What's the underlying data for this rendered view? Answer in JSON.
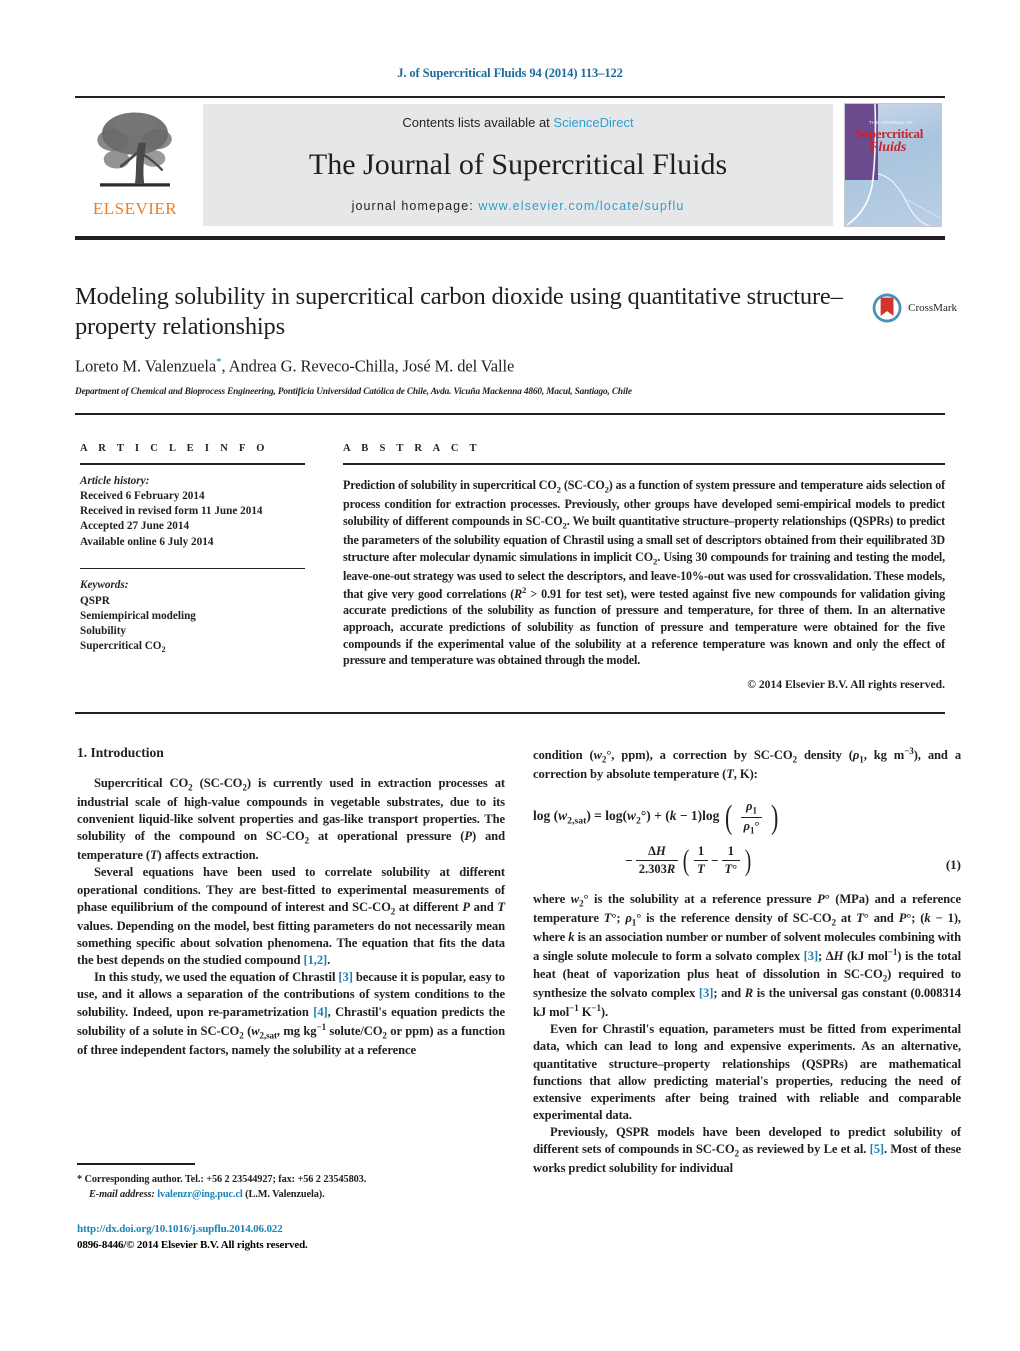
{
  "running_head": "J. of Supercritical Fluids 94 (2014) 113–122",
  "masthead": {
    "publisher_name": "ELSEVIER",
    "contents_prefix": "Contents lists available at ",
    "contents_link": "ScienceDirect",
    "journal_title": "The Journal of Supercritical Fluids",
    "homepage_prefix": "journal homepage: ",
    "homepage_url": "www.elsevier.com/locate/supflu",
    "cover": {
      "line1": "THE JOURNAL OF",
      "line2": "Supercritical",
      "line3": "Fluids"
    }
  },
  "title": "Modeling solubility in supercritical carbon dioxide using quantitative structure–property relationships",
  "authors_html": "Loreto M. Valenzuela<sup>*</sup>, Andrea G. Reveco-Chilla, José M. del Valle",
  "affiliation": "Department of Chemical and Bioprocess Engineering, Pontificia Universidad Católica de Chile, Avda. Vicuña Mackenna 4860, Macul, Santiago, Chile",
  "crossmark_label": "CrossMark",
  "article_info": {
    "heading": "A R T I C L E    I N F O",
    "history_label": "Article history:",
    "history": [
      "Received 6 February 2014",
      "Received in revised form 11 June 2014",
      "Accepted 27 June 2014",
      "Available online 6 July 2014"
    ],
    "keywords_label": "Keywords:",
    "keywords_html": [
      "QSPR",
      "Semiempirical modeling",
      "Solubility",
      "Supercritical CO<sub>2</sub>"
    ]
  },
  "abstract": {
    "heading": "A B S T R A C T",
    "body_html": "Prediction of solubility in supercritical CO<sub>2</sub> (SC-CO<sub>2</sub>) as a function of system pressure and temperature aids selection of process condition for extraction processes. Previously, other groups have developed semi-empirical models to predict solubility of different compounds in SC-CO<sub>2</sub>. We built quantitative structure–property relationships (QSPRs) to predict the parameters of the solubility equation of Chrastil using a small set of descriptors obtained from their equilibrated 3D structure after molecular dynamic simulations in implicit CO<sub>2</sub>. Using 30 compounds for training and testing the model, leave-one-out strategy was used to select the descriptors, and leave-10%-out was used for crossvalidation. These models, that give very good correlations (<i>R</i><sup>2</sup> &gt; 0.91 for test set), were tested against five new compounds for validation giving accurate predictions of the solubility as function of pressure and temperature, for three of them. In an alternative approach, accurate predictions of solubility as function of pressure and temperature were obtained for the five compounds if the experimental value of the solubility at a reference temperature was known and only the effect of pressure and temperature was obtained through the model.",
    "copyright": "© 2014 Elsevier B.V. All rights reserved."
  },
  "body": {
    "section_number_title": "1.  Introduction",
    "left_paragraphs_html": [
      "Supercritical CO<sub>2</sub> (SC-CO<sub>2</sub>) is currently used in extraction processes at industrial scale of high-value compounds in vegetable substrates, due to its convenient liquid-like solvent properties and gas-like transport properties. The solubility of the compound on SC-CO<sub>2</sub> at operational pressure (<i>P</i>) and temperature (<i>T</i>) affects extraction.",
      "Several equations have been used to correlate solubility at different operational conditions. They are best-fitted to experimental measurements of phase equilibrium of the compound of interest and SC-CO<sub>2</sub> at different <i>P</i> and <i>T</i> values. Depending on the model, best fitting parameters do not necessarily mean something specific about solvation phenomena. The equation that fits the data the best depends on the studied compound <span class=\"ref\">[1,2]</span>.",
      "In this study, we used the equation of Chrastil <span class=\"ref\">[3]</span> because it is popular, easy to use, and it allows a separation of the contributions of system conditions to the solubility. Indeed, upon re-parametrization <span class=\"ref\">[4]</span>, Chrastil's equation predicts the solubility of a solute in SC-CO<sub>2</sub> (<i>w</i><sub>2,sat</sub>, mg kg<sup>−1</sup> solute/CO<sub>2</sub> or ppm) as a function of three independent factors, namely the solubility at a reference"
    ],
    "right_intro_html": "condition (<i>w</i><sub>2</sub>°, ppm), a correction by SC-CO<sub>2</sub> density (<i>ρ</i><sub>1</sub>, kg m<sup>−3</sup>), and a correction by absolute temperature (<i>T</i>, K):",
    "equation": {
      "line1_html": "log (<i>w</i><sub>2,sat</sub>) = log(<i>w</i><sub>2</sub>°) + (<i>k</i> − 1)log",
      "frac1_num_html": "<i>ρ</i><sub>1</sub>",
      "frac1_den_html": "<i>ρ</i><sub>1</sub>°",
      "minus": "−",
      "frac2_num_html": "Δ<i>H</i>",
      "frac2_den_html": "2.303<i>R</i>",
      "frac3_num_html": "1",
      "frac3_den_html": "<i>T</i>",
      "frac4_num_html": "1",
      "frac4_den_html": "<i>T</i>°",
      "number": "(1)"
    },
    "right_paragraphs_html": [
      "where <i>w</i><sub>2</sub>° is the solubility at a reference pressure <i>P</i>° (MPa) and a reference temperature <i>T</i>°; <i>ρ</i><sub>1</sub>° is the reference density of SC-CO<sub>2</sub> at <i>T</i>° and <i>P</i>°; (<i>k</i> − 1), where <i>k</i> is an association number or number of solvent molecules combining with a single solute molecule to form a solvato complex <span class=\"ref\">[3]</span>; Δ<i>H</i> (kJ mol<sup>−1</sup>) is the total heat (heat of vaporization plus heat of dissolution in SC-CO<sub>2</sub>) required to synthesize the solvato complex <span class=\"ref\">[3]</span>; and <i>R</i> is the universal gas constant (0.008314 kJ mol<sup>−1</sup> K<sup>−1</sup>).",
      "Even for Chrastil's equation, parameters must be fitted from experimental data, which can lead to long and expensive experiments. As an alternative, quantitative structure–property relationships (QSPRs) are mathematical functions that allow predicting material's properties, reducing the need of extensive experiments after being trained with reliable and comparable experimental data.",
      "Previously, QSPR models have been developed to predict solubility of different sets of compounds in SC-CO<sub>2</sub> as reviewed by Le et al. <span class=\"ref\">[5]</span>. Most of these works predict solubility for individual"
    ]
  },
  "footnote": {
    "corresponding_html": "<b>*</b>  Corresponding author. Tel.: +56 2 23544927; fax: +56 2 23545803.",
    "email_label": "E-mail address:",
    "email": "lvalenzr@ing.puc.cl",
    "email_owner": "(L.M. Valenzuela)."
  },
  "doi": {
    "url": "http://dx.doi.org/10.1016/j.supflu.2014.06.022",
    "issn_line": "0896-8446/© 2014 Elsevier B.V. All rights reserved."
  },
  "colors": {
    "link": "#1b83b5",
    "running_head": "#1b6a9c",
    "elsevier_orange": "#f07c22",
    "band_gray": "#e6e7e8"
  }
}
